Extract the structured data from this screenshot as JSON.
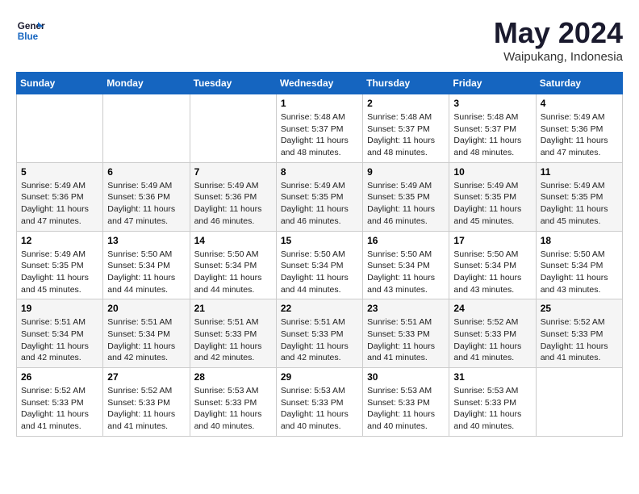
{
  "logo": {
    "line1": "General",
    "line2": "Blue"
  },
  "title": "May 2024",
  "subtitle": "Waipukang, Indonesia",
  "weekdays": [
    "Sunday",
    "Monday",
    "Tuesday",
    "Wednesday",
    "Thursday",
    "Friday",
    "Saturday"
  ],
  "weeks": [
    [
      {
        "day": "",
        "info": ""
      },
      {
        "day": "",
        "info": ""
      },
      {
        "day": "",
        "info": ""
      },
      {
        "day": "1",
        "info": "Sunrise: 5:48 AM\nSunset: 5:37 PM\nDaylight: 11 hours\nand 48 minutes."
      },
      {
        "day": "2",
        "info": "Sunrise: 5:48 AM\nSunset: 5:37 PM\nDaylight: 11 hours\nand 48 minutes."
      },
      {
        "day": "3",
        "info": "Sunrise: 5:48 AM\nSunset: 5:37 PM\nDaylight: 11 hours\nand 48 minutes."
      },
      {
        "day": "4",
        "info": "Sunrise: 5:49 AM\nSunset: 5:36 PM\nDaylight: 11 hours\nand 47 minutes."
      }
    ],
    [
      {
        "day": "5",
        "info": "Sunrise: 5:49 AM\nSunset: 5:36 PM\nDaylight: 11 hours\nand 47 minutes."
      },
      {
        "day": "6",
        "info": "Sunrise: 5:49 AM\nSunset: 5:36 PM\nDaylight: 11 hours\nand 47 minutes."
      },
      {
        "day": "7",
        "info": "Sunrise: 5:49 AM\nSunset: 5:36 PM\nDaylight: 11 hours\nand 46 minutes."
      },
      {
        "day": "8",
        "info": "Sunrise: 5:49 AM\nSunset: 5:35 PM\nDaylight: 11 hours\nand 46 minutes."
      },
      {
        "day": "9",
        "info": "Sunrise: 5:49 AM\nSunset: 5:35 PM\nDaylight: 11 hours\nand 46 minutes."
      },
      {
        "day": "10",
        "info": "Sunrise: 5:49 AM\nSunset: 5:35 PM\nDaylight: 11 hours\nand 45 minutes."
      },
      {
        "day": "11",
        "info": "Sunrise: 5:49 AM\nSunset: 5:35 PM\nDaylight: 11 hours\nand 45 minutes."
      }
    ],
    [
      {
        "day": "12",
        "info": "Sunrise: 5:49 AM\nSunset: 5:35 PM\nDaylight: 11 hours\nand 45 minutes."
      },
      {
        "day": "13",
        "info": "Sunrise: 5:50 AM\nSunset: 5:34 PM\nDaylight: 11 hours\nand 44 minutes."
      },
      {
        "day": "14",
        "info": "Sunrise: 5:50 AM\nSunset: 5:34 PM\nDaylight: 11 hours\nand 44 minutes."
      },
      {
        "day": "15",
        "info": "Sunrise: 5:50 AM\nSunset: 5:34 PM\nDaylight: 11 hours\nand 44 minutes."
      },
      {
        "day": "16",
        "info": "Sunrise: 5:50 AM\nSunset: 5:34 PM\nDaylight: 11 hours\nand 43 minutes."
      },
      {
        "day": "17",
        "info": "Sunrise: 5:50 AM\nSunset: 5:34 PM\nDaylight: 11 hours\nand 43 minutes."
      },
      {
        "day": "18",
        "info": "Sunrise: 5:50 AM\nSunset: 5:34 PM\nDaylight: 11 hours\nand 43 minutes."
      }
    ],
    [
      {
        "day": "19",
        "info": "Sunrise: 5:51 AM\nSunset: 5:34 PM\nDaylight: 11 hours\nand 42 minutes."
      },
      {
        "day": "20",
        "info": "Sunrise: 5:51 AM\nSunset: 5:34 PM\nDaylight: 11 hours\nand 42 minutes."
      },
      {
        "day": "21",
        "info": "Sunrise: 5:51 AM\nSunset: 5:33 PM\nDaylight: 11 hours\nand 42 minutes."
      },
      {
        "day": "22",
        "info": "Sunrise: 5:51 AM\nSunset: 5:33 PM\nDaylight: 11 hours\nand 42 minutes."
      },
      {
        "day": "23",
        "info": "Sunrise: 5:51 AM\nSunset: 5:33 PM\nDaylight: 11 hours\nand 41 minutes."
      },
      {
        "day": "24",
        "info": "Sunrise: 5:52 AM\nSunset: 5:33 PM\nDaylight: 11 hours\nand 41 minutes."
      },
      {
        "day": "25",
        "info": "Sunrise: 5:52 AM\nSunset: 5:33 PM\nDaylight: 11 hours\nand 41 minutes."
      }
    ],
    [
      {
        "day": "26",
        "info": "Sunrise: 5:52 AM\nSunset: 5:33 PM\nDaylight: 11 hours\nand 41 minutes."
      },
      {
        "day": "27",
        "info": "Sunrise: 5:52 AM\nSunset: 5:33 PM\nDaylight: 11 hours\nand 41 minutes."
      },
      {
        "day": "28",
        "info": "Sunrise: 5:53 AM\nSunset: 5:33 PM\nDaylight: 11 hours\nand 40 minutes."
      },
      {
        "day": "29",
        "info": "Sunrise: 5:53 AM\nSunset: 5:33 PM\nDaylight: 11 hours\nand 40 minutes."
      },
      {
        "day": "30",
        "info": "Sunrise: 5:53 AM\nSunset: 5:33 PM\nDaylight: 11 hours\nand 40 minutes."
      },
      {
        "day": "31",
        "info": "Sunrise: 5:53 AM\nSunset: 5:33 PM\nDaylight: 11 hours\nand 40 minutes."
      },
      {
        "day": "",
        "info": ""
      }
    ]
  ]
}
